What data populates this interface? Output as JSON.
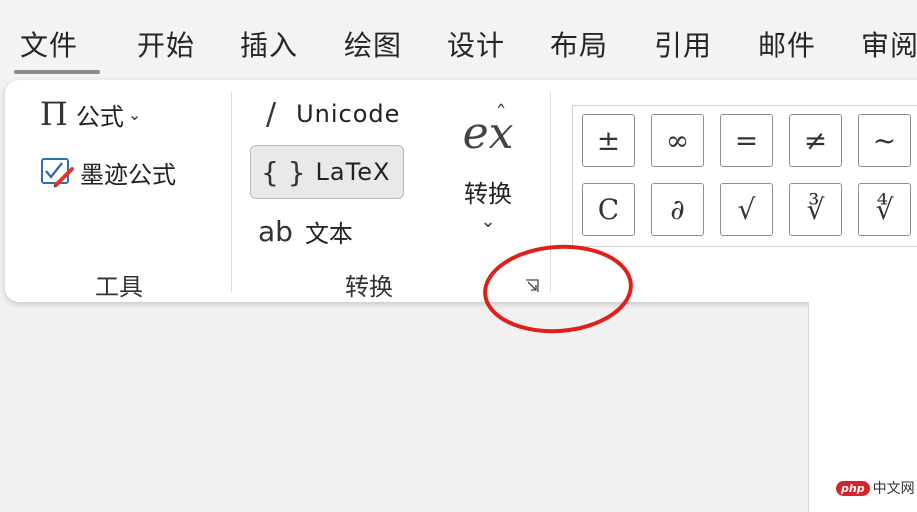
{
  "tabs": [
    {
      "label": "文件",
      "active": true
    },
    {
      "label": "开始"
    },
    {
      "label": "插入"
    },
    {
      "label": "绘图"
    },
    {
      "label": "设计"
    },
    {
      "label": "布局"
    },
    {
      "label": "引用"
    },
    {
      "label": "邮件"
    },
    {
      "label": "审阅"
    }
  ],
  "tools_group": {
    "equation_label": "公式",
    "ink_equation_label": "墨迹公式",
    "group_label": "工具"
  },
  "conversions_group": {
    "unicode_label": "Unicode",
    "latex_label": "LaTeX",
    "text_label": "文本",
    "convert_label": "转换",
    "group_label": "转换"
  },
  "symbols": {
    "row1": [
      "±",
      "∞",
      "=",
      "≠",
      "~"
    ],
    "row2": [
      "C",
      "∂",
      "√",
      "∛",
      "∜"
    ]
  },
  "watermark": {
    "badge": "php",
    "text": "中文网"
  },
  "colors": {
    "annotation": "#e0201b",
    "latex_pressed_bg": "#e9e9e9"
  }
}
